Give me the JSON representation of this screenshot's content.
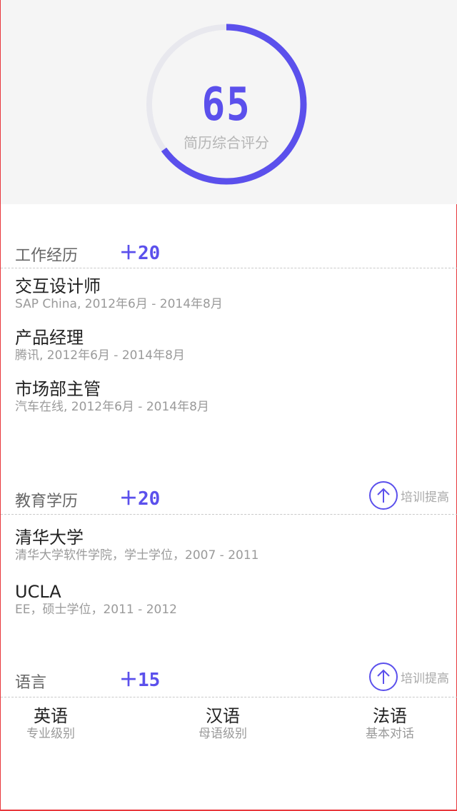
{
  "score": {
    "value": "65",
    "label": "简历综合评分",
    "fraction": 0.65,
    "accent": "#5b50ec",
    "track": "#e8e8ee"
  },
  "work": {
    "title": "工作经历",
    "bonus": "＋20",
    "items": [
      {
        "title": "交互设计师",
        "sub": "SAP China, 2012年6月 - 2014年8月"
      },
      {
        "title": "产品经理",
        "sub": "腾讯, 2012年6月 - 2014年8月"
      },
      {
        "title": "市场部主管",
        "sub": "汽车在线, 2012年6月 - 2014年8月"
      }
    ]
  },
  "education": {
    "title": "教育学历",
    "bonus": "＋20",
    "train_label": "培训提高",
    "train_icon": "arrow-up-circle-icon",
    "items": [
      {
        "title": "清华大学",
        "sub": "清华大学软件学院，学士学位，2007 - 2011"
      },
      {
        "title": "UCLA",
        "sub": "EE，硕士学位，2011 - 2012"
      }
    ]
  },
  "language": {
    "title": "语言",
    "bonus": "＋15",
    "train_label": "培训提高",
    "train_icon": "arrow-up-circle-icon",
    "items": [
      {
        "name": "英语",
        "level": "专业级别"
      },
      {
        "name": "汉语",
        "level": "母语级别"
      },
      {
        "name": "法语",
        "level": "基本对话"
      }
    ]
  }
}
